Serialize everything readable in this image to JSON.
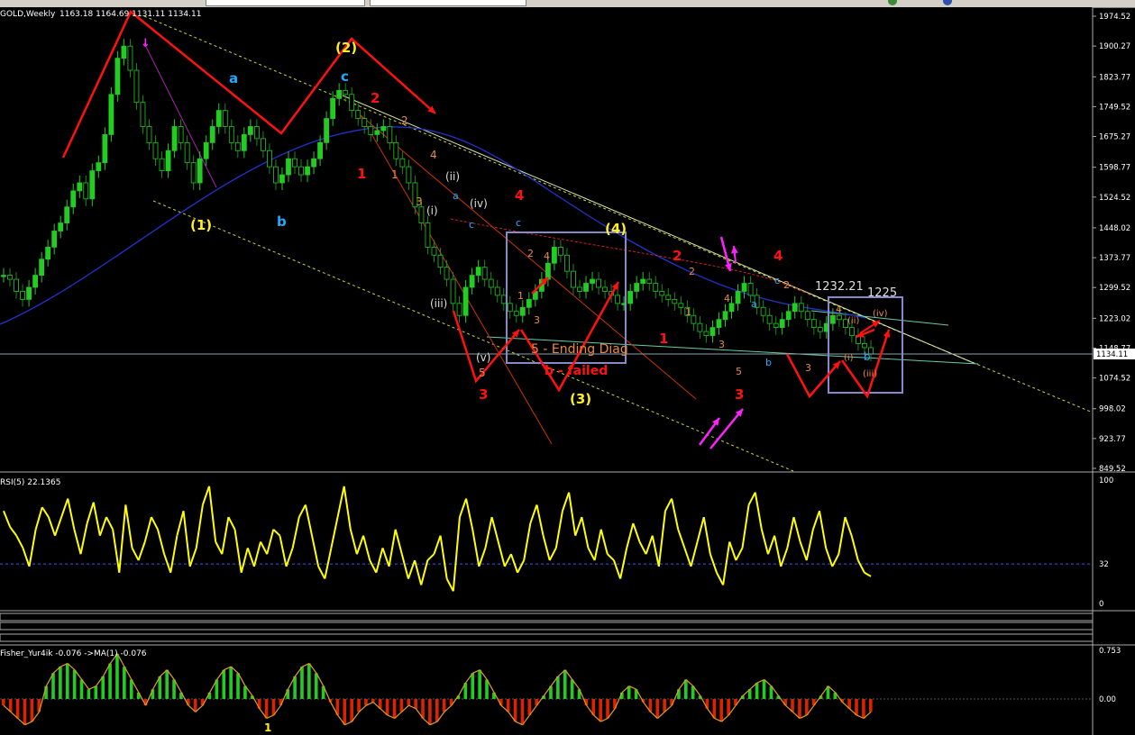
{
  "window": {
    "title": "GOLD,Weekly",
    "ohlc": "1163.18 1164.69 1131.11 1134.11",
    "current_price": "1134.11"
  },
  "colors": {
    "background": "#000000",
    "bull_candle": "#22cc22",
    "bear_candle": "#1a8a1a",
    "wave_red": "#ff1111",
    "wave_yellow": "#ffee22",
    "wave_cyan": "#22aaff",
    "wave_orange": "#e88b3c",
    "wave_white": "#dddddd",
    "magenta": "#ff22ff",
    "rsi_line": "#ffff00",
    "hist_up": "#22cc22",
    "hist_down": "#dd2200",
    "box": "#8888cc"
  },
  "price_axis": {
    "ticks": [
      "1974.52",
      "1900.27",
      "1823.77",
      "1749.52",
      "1675.27",
      "1598.77",
      "1524.52",
      "1448.02",
      "1373.77",
      "1299.52",
      "1223.02",
      "1148.77",
      "1074.52",
      "998.02",
      "923.77",
      "849.52"
    ]
  },
  "rsi_panel": {
    "label": "RSI(5) 22.1365",
    "ticks": [
      "100",
      "32",
      "0"
    ],
    "level": 32
  },
  "osc_panel": {
    "label": "Fisher_Yur4ik -0.076  ->MA(1) -0.076",
    "ticks": [
      "0.753",
      "0.00"
    ],
    "marker": "1"
  },
  "chart_data": [
    {
      "type": "line",
      "title": "GOLD,Weekly",
      "ylim": [
        849.52,
        1974.52
      ],
      "series": [
        {
          "name": "",
          "values": [
            1330,
            1320,
            1290,
            1270,
            1300,
            1330,
            1370,
            1400,
            1440,
            1460,
            1500,
            1540,
            1560,
            1520,
            1590,
            1610,
            1680,
            1780,
            1870,
            1900,
            1840,
            1760,
            1700,
            1660,
            1620,
            1590,
            1640,
            1700,
            1660,
            1610,
            1560,
            1620,
            1660,
            1700,
            1740,
            1700,
            1660,
            1640,
            1680,
            1700,
            1670,
            1640,
            1600,
            1560,
            1580,
            1620,
            1600,
            1580,
            1600,
            1620,
            1660,
            1720,
            1770,
            1790,
            1780,
            1740,
            1720,
            1700,
            1680,
            1690,
            1700,
            1660,
            1620,
            1600,
            1560,
            1500,
            1460,
            1400,
            1380,
            1350,
            1320,
            1260,
            1230,
            1300,
            1330,
            1350,
            1320,
            1300,
            1280,
            1260,
            1240,
            1230,
            1250,
            1270,
            1290,
            1320,
            1360,
            1400,
            1380,
            1340,
            1300,
            1290,
            1310,
            1320,
            1300,
            1290,
            1280,
            1260,
            1260,
            1290,
            1310,
            1320,
            1310,
            1290,
            1280,
            1270,
            1260,
            1250,
            1230,
            1210,
            1190,
            1180,
            1200,
            1220,
            1240,
            1260,
            1290,
            1310,
            1280,
            1250,
            1230,
            1210,
            1200,
            1220,
            1240,
            1260,
            1240,
            1220,
            1200,
            1190,
            1210,
            1230,
            1220,
            1200,
            1180,
            1160,
            1150,
            1134
          ]
        }
      ]
    },
    {
      "type": "line",
      "title": "RSI(5) 22.1365",
      "ylim": [
        0,
        100
      ],
      "series": [
        {
          "name": "",
          "values": [
            75,
            62,
            55,
            45,
            30,
            60,
            78,
            70,
            55,
            70,
            85,
            60,
            40,
            65,
            82,
            55,
            70,
            60,
            25,
            80,
            45,
            35,
            50,
            70,
            60,
            40,
            25,
            55,
            75,
            30,
            45,
            80,
            95,
            50,
            40,
            70,
            60,
            25,
            45,
            30,
            50,
            40,
            60,
            55,
            30,
            45,
            70,
            80,
            55,
            30,
            20,
            45,
            70,
            95,
            60,
            40,
            55,
            35,
            25,
            45,
            30,
            60,
            40,
            20,
            35,
            15,
            35,
            40,
            55,
            20,
            10,
            70,
            85,
            60,
            30,
            45,
            70,
            50,
            30,
            40,
            25,
            35,
            65,
            80,
            55,
            35,
            45,
            75,
            90,
            55,
            70,
            45,
            35,
            60,
            40,
            35,
            20,
            45,
            65,
            50,
            40,
            55,
            30,
            75,
            85,
            60,
            45,
            30,
            50,
            70,
            40,
            25,
            15,
            50,
            35,
            45,
            80,
            90,
            60,
            40,
            55,
            30,
            45,
            70,
            50,
            35,
            60,
            75,
            45,
            30,
            40,
            70,
            55,
            35,
            25,
            22
          ]
        }
      ]
    },
    {
      "type": "bar",
      "title": "Fisher_Yur4ik -0.076  ->MA(1) -0.076",
      "ylim": [
        -0.5,
        0.753
      ],
      "series": [
        {
          "name": "",
          "values": [
            -0.1,
            -0.2,
            -0.3,
            -0.4,
            -0.35,
            -0.2,
            0.2,
            0.4,
            0.5,
            0.55,
            0.45,
            0.3,
            0.15,
            0.2,
            0.35,
            0.55,
            0.7,
            0.5,
            0.3,
            0.1,
            -0.1,
            0.15,
            0.35,
            0.45,
            0.3,
            0.1,
            -0.1,
            -0.2,
            -0.1,
            0.1,
            0.3,
            0.45,
            0.5,
            0.4,
            0.2,
            0.05,
            -0.15,
            -0.3,
            -0.25,
            -0.1,
            0.15,
            0.35,
            0.5,
            0.55,
            0.4,
            0.2,
            -0.05,
            -0.25,
            -0.4,
            -0.35,
            -0.2,
            -0.1,
            -0.05,
            -0.15,
            -0.25,
            -0.3,
            -0.2,
            -0.1,
            -0.15,
            -0.3,
            -0.4,
            -0.35,
            -0.2,
            -0.1,
            0.05,
            0.25,
            0.4,
            0.45,
            0.3,
            0.1,
            -0.1,
            -0.2,
            -0.35,
            -0.4,
            -0.25,
            -0.1,
            0.05,
            0.2,
            0.35,
            0.45,
            0.3,
            0.15,
            -0.1,
            -0.25,
            -0.35,
            -0.3,
            -0.15,
            0.1,
            0.2,
            0.15,
            -0.05,
            -0.2,
            -0.3,
            -0.2,
            -0.1,
            0.15,
            0.3,
            0.2,
            0.05,
            -0.15,
            -0.3,
            -0.35,
            -0.25,
            -0.1,
            0.05,
            0.15,
            0.25,
            0.3,
            0.2,
            0.05,
            -0.1,
            -0.2,
            -0.3,
            -0.25,
            -0.1,
            0.05,
            0.2,
            0.1,
            -0.05,
            -0.15,
            -0.25,
            -0.3,
            -0.2
          ]
        }
      ]
    }
  ],
  "annotations": [
    {
      "t": "(1)",
      "c": "wave_yellow"
    },
    {
      "t": "(2)",
      "c": "wave_yellow"
    },
    {
      "t": "(3)",
      "c": "wave_yellow"
    },
    {
      "t": "(4)",
      "c": "wave_yellow"
    },
    {
      "t": "a",
      "c": "wave_cyan"
    },
    {
      "t": "b",
      "c": "wave_cyan"
    },
    {
      "t": "c",
      "c": "wave_cyan"
    },
    {
      "t": "c",
      "c": "wave_cyan"
    },
    {
      "t": "a",
      "c": "wave_cyan"
    },
    {
      "t": "c",
      "c": "wave_cyan"
    },
    {
      "t": "a",
      "c": "wave_cyan"
    },
    {
      "t": "b",
      "c": "wave_cyan"
    },
    {
      "t": "c",
      "c": "wave_cyan"
    },
    {
      "t": "b",
      "c": "wave_cyan"
    },
    {
      "t": "2",
      "c": "wave_red"
    },
    {
      "t": "1",
      "c": "wave_red"
    },
    {
      "t": "4",
      "c": "wave_red"
    },
    {
      "t": "3",
      "c": "wave_red"
    },
    {
      "t": "2",
      "c": "wave_red"
    },
    {
      "t": "1",
      "c": "wave_red"
    },
    {
      "t": "4",
      "c": "wave_red"
    },
    {
      "t": "3",
      "c": "wave_red"
    },
    {
      "t": "2",
      "c": "wave_orange"
    },
    {
      "t": "1",
      "c": "wave_orange"
    },
    {
      "t": "3",
      "c": "wave_orange"
    },
    {
      "t": "4",
      "c": "wave_orange"
    },
    {
      "t": "5",
      "c": "wave_orange"
    },
    {
      "t": "1",
      "c": "wave_orange"
    },
    {
      "t": "2",
      "c": "wave_orange"
    },
    {
      "t": "3",
      "c": "wave_orange"
    },
    {
      "t": "4",
      "c": "wave_orange"
    },
    {
      "t": "2",
      "c": "wave_orange"
    },
    {
      "t": "1",
      "c": "wave_orange"
    },
    {
      "t": "4",
      "c": "wave_orange"
    },
    {
      "t": "3",
      "c": "wave_orange"
    },
    {
      "t": "5",
      "c": "wave_orange"
    },
    {
      "t": "2",
      "c": "wave_orange"
    },
    {
      "t": "3",
      "c": "wave_orange"
    },
    {
      "t": "4",
      "c": "wave_orange"
    },
    {
      "t": "(i)",
      "c": "wave_white"
    },
    {
      "t": "(ii)",
      "c": "wave_white"
    },
    {
      "t": "(iii)",
      "c": "wave_white"
    },
    {
      "t": "(iv)",
      "c": "wave_white"
    },
    {
      "t": "(v)",
      "c": "wave_white"
    },
    {
      "t": "5 - Ending Diag",
      "c": "wave_orange"
    },
    {
      "t": "b - failed",
      "c": "wave_red"
    },
    {
      "t": "1232.21",
      "c": "wave_white"
    },
    {
      "t": "1225",
      "c": "wave_white"
    },
    {
      "t": "(ii)",
      "c": "wave_orange"
    },
    {
      "t": "(iv)",
      "c": "wave_orange"
    },
    {
      "t": "(i)",
      "c": "wave_orange"
    },
    {
      "t": "(iii)",
      "c": "wave_orange"
    }
  ]
}
